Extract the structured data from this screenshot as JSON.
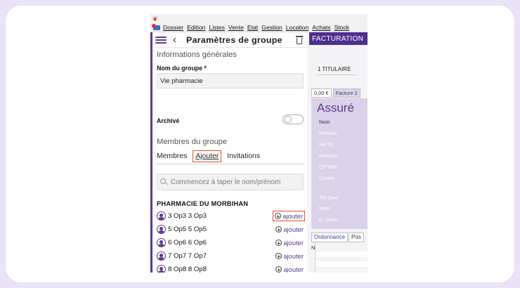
{
  "menubar": {
    "items": [
      "Dossier",
      "Edition",
      "Listes",
      "Vente",
      "Etat",
      "Gestion",
      "Location",
      "Achats",
      "Stock"
    ]
  },
  "panel": {
    "title": "Paramètres de groupe",
    "info_section": "Informations générales",
    "group_name_label": "Nom du groupe *",
    "group_name_value": "Vie pharmacie",
    "archived_label": "Archivé",
    "archived_on": false,
    "members_section": "Membres du groupe",
    "tabs": [
      {
        "label": "Membres",
        "active": false
      },
      {
        "label": "Ajouter",
        "active": true
      },
      {
        "label": "Invitations",
        "active": false
      }
    ],
    "search_placeholder": "Commencez à taper le nom/prénom",
    "organization": "PHARMACIE DU MORBIHAN",
    "add_label": "ajouter",
    "members": [
      {
        "name": "3 Op3 3 Op3",
        "highlighted": true
      },
      {
        "name": "5 Op5 5 Op5",
        "highlighted": false
      },
      {
        "name": "6 Op6 6 Op6",
        "highlighted": false
      },
      {
        "name": "7 Op7 7 Op7",
        "highlighted": false
      },
      {
        "name": "8 Op8 8 Op8",
        "highlighted": false
      }
    ]
  },
  "background_app": {
    "header": "FACTURATION",
    "titulaire": "1 TITULAIRE",
    "invoice_tabs": [
      "0,00 €",
      "Facture 2"
    ],
    "assure_title": "Assuré",
    "fields": [
      "Nom",
      "Prénom",
      "No SS",
      "Adresse",
      "CP Ville",
      "Centre",
      "Tél Dom",
      "Note",
      "D. visite"
    ],
    "bottom_tabs": [
      "Ordonnance",
      "Pos"
    ],
    "grid_header": "N"
  },
  "colors": {
    "accent": "#5b3b8c",
    "highlight": "#e1512a",
    "page_background": "#e9e2f8"
  }
}
